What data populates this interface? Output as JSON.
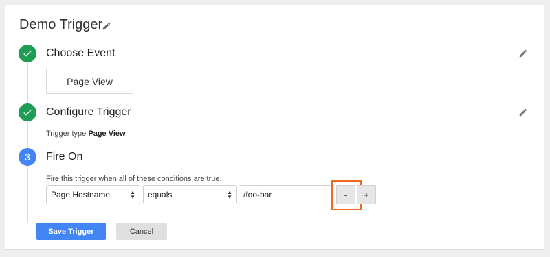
{
  "trigger": {
    "title": "Demo Trigger"
  },
  "steps": [
    {
      "label": "Choose Event",
      "status": "complete",
      "event_value": "Page View"
    },
    {
      "label": "Configure Trigger",
      "status": "complete",
      "type_prefix": "Trigger type",
      "type_value": "Page View"
    },
    {
      "number": "3",
      "label": "Fire On",
      "description": "Fire this trigger when all of these conditions are true."
    }
  ],
  "condition": {
    "variable": "Page Hostname",
    "operator": "equals",
    "value": "/foo-bar",
    "remove_label": "-",
    "add_label": "+"
  },
  "actions": {
    "save_label": "Save Trigger",
    "cancel_label": "Cancel"
  },
  "icons": {
    "check": "check-icon",
    "edit": "pencil-icon",
    "select_arrows": "up-down-arrows-icon"
  },
  "colors": {
    "success": "#1e9e54",
    "primary": "#4285f4",
    "highlight": "#f26a21"
  }
}
